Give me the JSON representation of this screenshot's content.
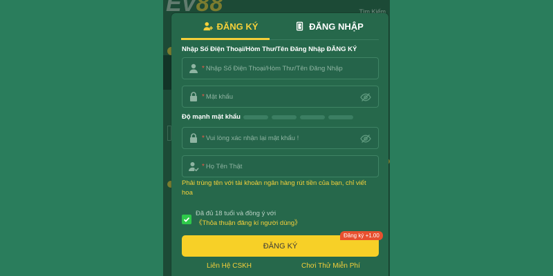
{
  "background": {
    "logo_prefix": "Ev",
    "logo_suffix": "88",
    "search_label": "Tìm Kiếm"
  },
  "tabs": [
    {
      "label": "ĐĂNG KÝ",
      "icon": "user-add-icon",
      "active": true
    },
    {
      "label": "ĐĂNG NHẬP",
      "icon": "login-door-icon",
      "active": false
    }
  ],
  "form": {
    "account_label": "Nhập Số Điện Thoại/Hòm Thư/Tên Đăng Nhập ĐĂNG KÝ",
    "account_placeholder": "Nhập Số Điện Thoại/Hòm Thư/Tên Đăng Nhập",
    "password_placeholder": "Mật khẩu",
    "required_mark": "*",
    "strength_label": "Độ mạnh mật khẩu",
    "strength_segments": 4,
    "strength_level": 0,
    "confirm_placeholder": "Vui lòng xác nhận lại mật khẩu !",
    "realname_placeholder": "Họ Tên Thật",
    "realname_hint": "Phải trùng tên với tài khoản ngân hàng rút tiền của bạn, chỉ viết hoa"
  },
  "agreement": {
    "checked": true,
    "text": "Đã đủ 18 tuổi và đồng ý với ",
    "link": "《Thỏa thuận đăng kí người dùng》"
  },
  "register_button": {
    "label": "ĐĂNG KÝ",
    "bonus_tag": "Đăng ký +1.00"
  },
  "footer": {
    "support": "Liên Hệ CSKH",
    "free_play": "Chơi Thử Miễn Phí"
  },
  "colors": {
    "page_bg": "#2a7d5c",
    "modal_bg": "#26684b",
    "accent": "#f5d03a",
    "button": "#f7d027",
    "checkbox": "#2ec94a",
    "bonus_tag": "#e8502f"
  }
}
